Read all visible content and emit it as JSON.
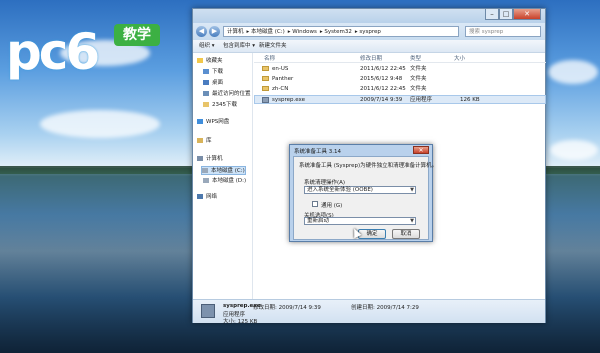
{
  "brand": {
    "logo_text": "pc6",
    "badge": "教学"
  },
  "explorer": {
    "address_parts": [
      "计算机",
      "本地磁盘 (C:)",
      "Windows",
      "System32",
      "sysprep"
    ],
    "search_placeholder": "搜索 sysprep",
    "toolbar": {
      "organize": "组织 ▾",
      "include": "包含到库中 ▾",
      "new_folder": "新建文件夹"
    },
    "nav": {
      "favorites": "收藏夹",
      "downloads": "下载",
      "desktop": "桌面",
      "recent": "最近访问的位置",
      "d2345": "2345下载",
      "wps": "WPS网盘",
      "libraries": "库",
      "computer": "计算机",
      "drive_c": "本地磁盘 (C:)",
      "drive_d": "本地磁盘 (D:)",
      "network": "网络"
    },
    "columns": {
      "name": "名称",
      "date": "修改日期",
      "type": "类型",
      "size": "大小"
    },
    "files": [
      {
        "name": "en-US",
        "date": "2011/6/12 22:45",
        "type": "文件夹",
        "size": ""
      },
      {
        "name": "Panther",
        "date": "2015/6/12 9:48",
        "type": "文件夹",
        "size": ""
      },
      {
        "name": "zh-CN",
        "date": "2011/6/12 22:45",
        "type": "文件夹",
        "size": ""
      },
      {
        "name": "sysprep.exe",
        "date": "2009/7/14 9:39",
        "type": "应用程序",
        "size": "126 KB"
      }
    ],
    "details": {
      "name": "sysprep.exe",
      "modified_label": "修改日期: 2009/7/14 9:39",
      "created_label": "创建日期: 2009/7/14 7:29",
      "type": "应用程序",
      "size_label": "大小: 125 KB"
    }
  },
  "dialog": {
    "title": "系统准备工具 3.14",
    "description": "系统准备工具 (Sysprep)为硬件独立和清理准备计算机。",
    "cleanup_label": "系统清理操作(A)",
    "cleanup_value": "进入系统全新体验 (OOBE)",
    "generalize_label": "通用 (G)",
    "shutdown_label": "关机选项(S)",
    "shutdown_value": "重新启动",
    "ok": "确定",
    "cancel": "取消"
  }
}
